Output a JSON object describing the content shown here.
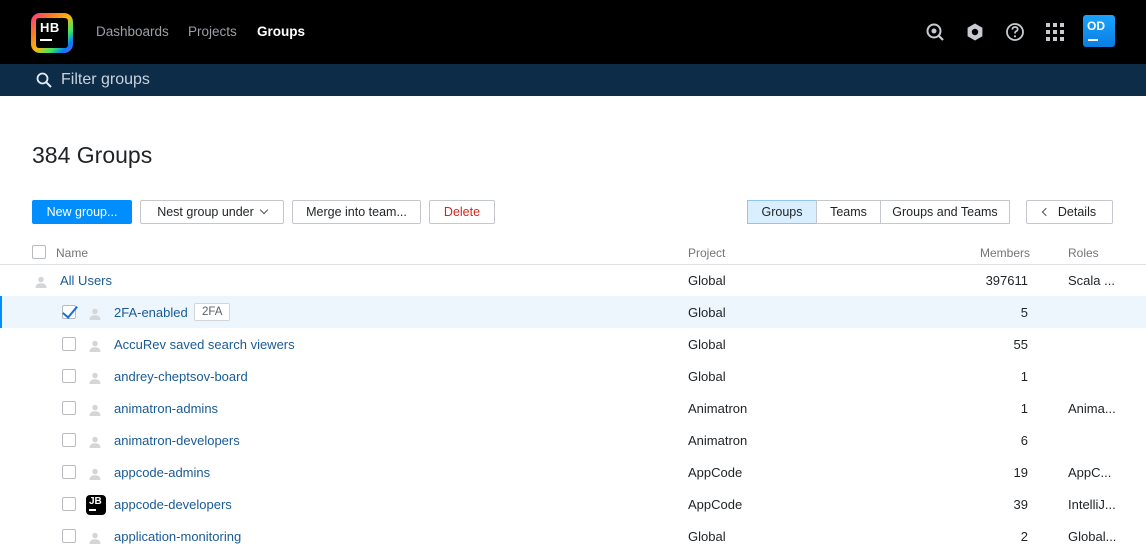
{
  "header": {
    "logo_text": "HB",
    "nav": [
      {
        "label": "Dashboards"
      },
      {
        "label": "Projects"
      },
      {
        "label": "Groups"
      }
    ],
    "avatar_initials": "OD",
    "icons": [
      "search-analysis-icon",
      "settings-icon",
      "help-icon",
      "apps-grid-icon"
    ]
  },
  "filter": {
    "placeholder": "Filter groups"
  },
  "page_title": "384 Groups",
  "toolbar": {
    "new_group": "New group...",
    "nest_group": "Nest group under",
    "merge": "Merge into team...",
    "delete": "Delete",
    "view_groups": "Groups",
    "view_teams": "Teams",
    "view_groups_teams": "Groups and Teams",
    "details": "Details"
  },
  "table": {
    "headers": {
      "name": "Name",
      "project": "Project",
      "members": "Members",
      "roles": "Roles"
    },
    "rows": [
      {
        "name": "All Users",
        "tag": "",
        "project": "Global",
        "members": "397611",
        "roles": "Scala ..."
      },
      {
        "name": "2FA-enabled",
        "tag": "2FA",
        "project": "Global",
        "members": "5",
        "roles": ""
      },
      {
        "name": "AccuRev saved search viewers",
        "tag": "",
        "project": "Global",
        "members": "55",
        "roles": ""
      },
      {
        "name": "andrey-cheptsov-board",
        "tag": "",
        "project": "Global",
        "members": "1",
        "roles": ""
      },
      {
        "name": "animatron-admins",
        "tag": "",
        "project": "Animatron",
        "members": "1",
        "roles": "Anima..."
      },
      {
        "name": "animatron-developers",
        "tag": "",
        "project": "Animatron",
        "members": "6",
        "roles": ""
      },
      {
        "name": "appcode-admins",
        "tag": "",
        "project": "AppCode",
        "members": "19",
        "roles": "AppC..."
      },
      {
        "name": "appcode-developers",
        "tag": "",
        "project": "AppCode",
        "members": "39",
        "roles": "IntelliJ..."
      },
      {
        "name": "application-monitoring",
        "tag": "",
        "project": "Global",
        "members": "2",
        "roles": "Global..."
      }
    ]
  },
  "colors": {
    "header_bg": "#000000",
    "filter_bg": "#0d2c48",
    "primary": "#008eff",
    "link": "#1a5a96",
    "danger": "#d4261c"
  }
}
